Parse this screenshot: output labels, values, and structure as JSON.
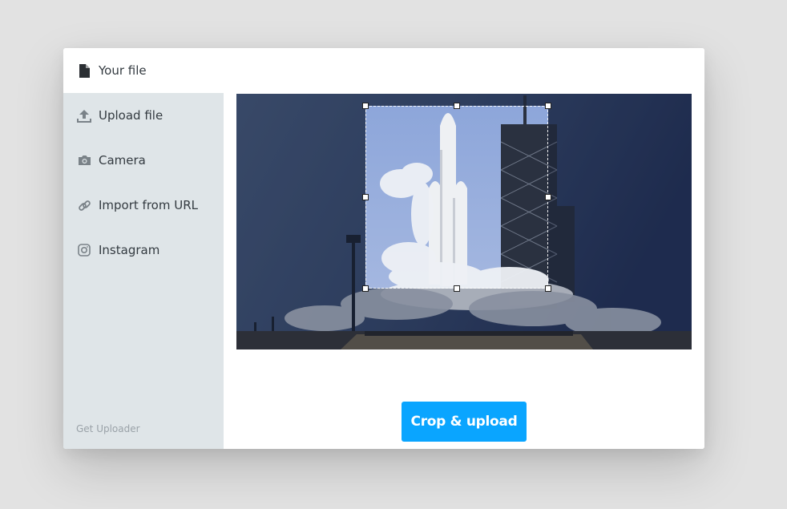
{
  "sidebar": {
    "file_item": {
      "label": "Your file",
      "icon": "document-icon"
    },
    "items": [
      {
        "label": "Upload file",
        "icon": "upload-icon"
      },
      {
        "label": "Camera",
        "icon": "camera-icon"
      },
      {
        "label": "Import from URL",
        "icon": "link-icon"
      },
      {
        "label": "Instagram",
        "icon": "instagram-icon"
      }
    ],
    "footer_link": "Get Uploader"
  },
  "main": {
    "action_button": "Crop & upload"
  },
  "colors": {
    "accent": "#0aa5ff",
    "sidebar_bg": "#dfe5e8",
    "backdrop": "#e2e2e2"
  }
}
